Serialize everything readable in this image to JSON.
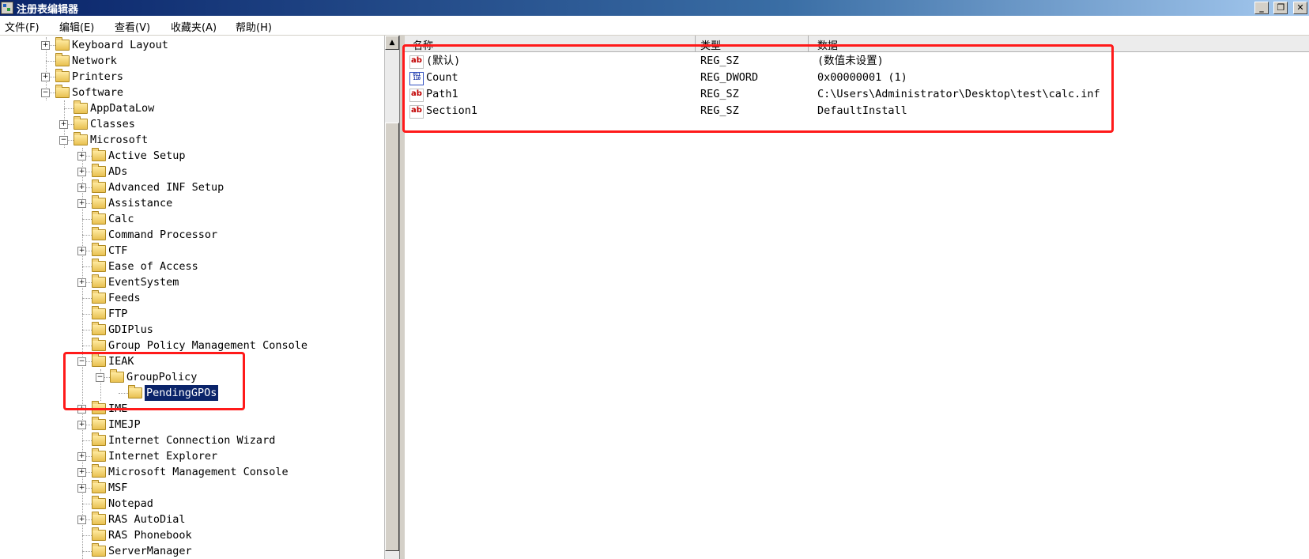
{
  "window": {
    "title": "注册表编辑器",
    "minimize": "_",
    "restore": "❐",
    "close": "✕"
  },
  "menu": [
    "文件(F)",
    "编辑(E)",
    "查看(V)",
    "收藏夹(A)",
    "帮助(H)"
  ],
  "tree": {
    "expand_glyph": "+",
    "collapse_glyph": "−",
    "nodes": [
      {
        "label": "Keyboard Layout",
        "depth": 0,
        "toggle": "expand"
      },
      {
        "label": "Network",
        "depth": 0,
        "toggle": "none"
      },
      {
        "label": "Printers",
        "depth": 0,
        "toggle": "expand"
      },
      {
        "label": "Software",
        "depth": 0,
        "toggle": "collapse"
      },
      {
        "label": "AppDataLow",
        "depth": 1,
        "toggle": "none"
      },
      {
        "label": "Classes",
        "depth": 1,
        "toggle": "expand"
      },
      {
        "label": "Microsoft",
        "depth": 1,
        "toggle": "collapse"
      },
      {
        "label": "Active Setup",
        "depth": 2,
        "toggle": "expand"
      },
      {
        "label": "ADs",
        "depth": 2,
        "toggle": "expand"
      },
      {
        "label": "Advanced INF Setup",
        "depth": 2,
        "toggle": "expand"
      },
      {
        "label": "Assistance",
        "depth": 2,
        "toggle": "expand"
      },
      {
        "label": "Calc",
        "depth": 2,
        "toggle": "none"
      },
      {
        "label": "Command Processor",
        "depth": 2,
        "toggle": "none"
      },
      {
        "label": "CTF",
        "depth": 2,
        "toggle": "expand"
      },
      {
        "label": "Ease of Access",
        "depth": 2,
        "toggle": "none"
      },
      {
        "label": "EventSystem",
        "depth": 2,
        "toggle": "expand"
      },
      {
        "label": "Feeds",
        "depth": 2,
        "toggle": "none"
      },
      {
        "label": "FTP",
        "depth": 2,
        "toggle": "none"
      },
      {
        "label": "GDIPlus",
        "depth": 2,
        "toggle": "none"
      },
      {
        "label": "Group Policy Management Console",
        "depth": 2,
        "toggle": "none"
      },
      {
        "label": "IEAK",
        "depth": 2,
        "toggle": "collapse"
      },
      {
        "label": "GroupPolicy",
        "depth": 3,
        "toggle": "collapse"
      },
      {
        "label": "PendingGPOs",
        "depth": 4,
        "toggle": "none",
        "selected": true
      },
      {
        "label": "IME",
        "depth": 2,
        "toggle": "expand"
      },
      {
        "label": "IMEJP",
        "depth": 2,
        "toggle": "expand"
      },
      {
        "label": "Internet Connection Wizard",
        "depth": 2,
        "toggle": "none"
      },
      {
        "label": "Internet Explorer",
        "depth": 2,
        "toggle": "expand"
      },
      {
        "label": "Microsoft Management Console",
        "depth": 2,
        "toggle": "expand"
      },
      {
        "label": "MSF",
        "depth": 2,
        "toggle": "expand"
      },
      {
        "label": "Notepad",
        "depth": 2,
        "toggle": "none"
      },
      {
        "label": "RAS AutoDial",
        "depth": 2,
        "toggle": "expand"
      },
      {
        "label": "RAS Phonebook",
        "depth": 2,
        "toggle": "none"
      },
      {
        "label": "ServerManager",
        "depth": 2,
        "toggle": "none"
      }
    ]
  },
  "scrollbar": {
    "up_glyph": "▲"
  },
  "list": {
    "columns": {
      "name": "名称",
      "type": "类型",
      "data": "数据"
    },
    "rows": [
      {
        "icon": "string-value-icon",
        "icon_text": "ab",
        "name": "(默认)",
        "type": "REG_SZ",
        "data": "(数值未设置)"
      },
      {
        "icon": "dword-value-icon",
        "icon_text": "011 110",
        "name": "Count",
        "type": "REG_DWORD",
        "data": "0x00000001 (1)"
      },
      {
        "icon": "string-value-icon",
        "icon_text": "ab",
        "name": "Path1",
        "type": "REG_SZ",
        "data": "C:\\Users\\Administrator\\Desktop\\test\\calc.inf"
      },
      {
        "icon": "string-value-icon",
        "icon_text": "ab",
        "name": "Section1",
        "type": "REG_SZ",
        "data": "DefaultInstall"
      }
    ]
  },
  "colors": {
    "annotation": "#ff1a1a",
    "selection": "#0a246a",
    "titlebar": "#0a246a"
  }
}
